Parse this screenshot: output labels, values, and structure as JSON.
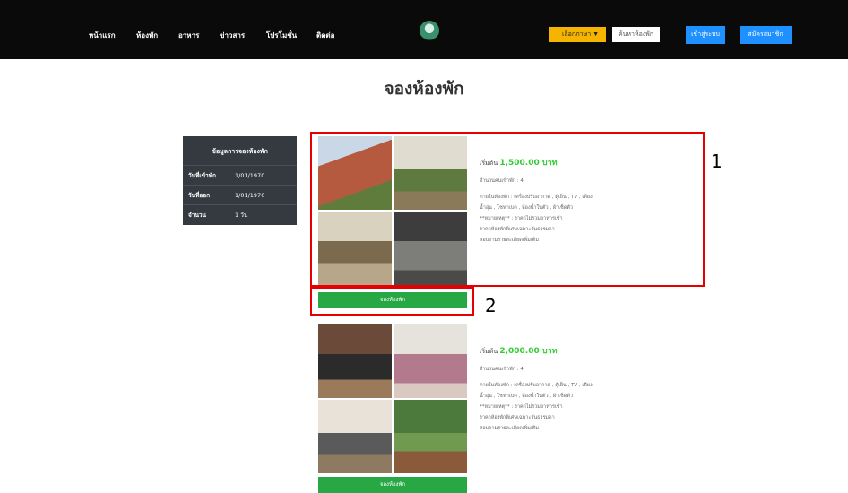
{
  "nav": {
    "links": [
      "หน้าแรก",
      "ห้องพัก",
      "อาหาร",
      "ข่าวสาร",
      "โปรโมชั่น",
      "ติดต่อ"
    ],
    "logo_icon": "resort-logo-icon",
    "language": "เลือกภาษา",
    "language_arrow": "▼",
    "search_label": "ค้นหาห้องพัก",
    "login_label": "เข้าสู่ระบบ",
    "register_label": "สมัครสมาชิก"
  },
  "page_title": "จองห้องพัก",
  "booking_summary": {
    "title": "ข้อมูลการจองห้องพัก",
    "rows": [
      {
        "label": "วันที่เข้าพัก",
        "value": "1/01/1970"
      },
      {
        "label": "วันที่ออก",
        "value": "1/01/1970"
      },
      {
        "label": "จำนวน",
        "value": "1 วัน"
      }
    ]
  },
  "rooms": [
    {
      "price_prefix": "เริ่มต้น",
      "price": "1,500.00 บาท",
      "guests": "จำนวนคนเข้าพัก : 4",
      "amenities": [
        "ภายในห้องพัก : เครื่องปรับอากาศ , ตู้เย็น , TV , เตียง",
        "น้ำอุ่น , โซฟาเบด , ห้องน้ำในตัว , ผ้าเช็ดตัว",
        "**หมายเหตุ** : ราคาไม่รวมอาหารเช้า",
        "ราคาห้องพักพิเศษเฉพาะวันธรรมดา",
        "สอบถามรายละเอียดเพิ่มเติม"
      ],
      "button": "จองห้องพัก"
    },
    {
      "price_prefix": "เริ่มต้น",
      "price": "2,000.00 บาท",
      "guests": "จำนวนคนเข้าพัก : 4",
      "amenities": [
        "ภายในห้องพัก : เครื่องปรับอากาศ , ตู้เย็น , TV , เตียง",
        "น้ำอุ่น , โซฟาเบด , ห้องน้ำในตัว , ผ้าเช็ดตัว",
        "**หมายเหตุ** : ราคาไม่รวมอาหารเช้า",
        "ราคาห้องพักพิเศษเฉพาะวันธรรมดา",
        "สอบถามรายละเอียดเพิ่มเติม"
      ],
      "button": "จองห้องพัก"
    }
  ],
  "annotations": [
    "1",
    "2"
  ],
  "colors": {
    "nav_bg": "#0a0a0a",
    "accent_yellow": "#f4b400",
    "accent_blue": "#1e90ff",
    "book_green": "#28a745",
    "price_green": "#33cc33",
    "highlight_red": "#e60000"
  }
}
